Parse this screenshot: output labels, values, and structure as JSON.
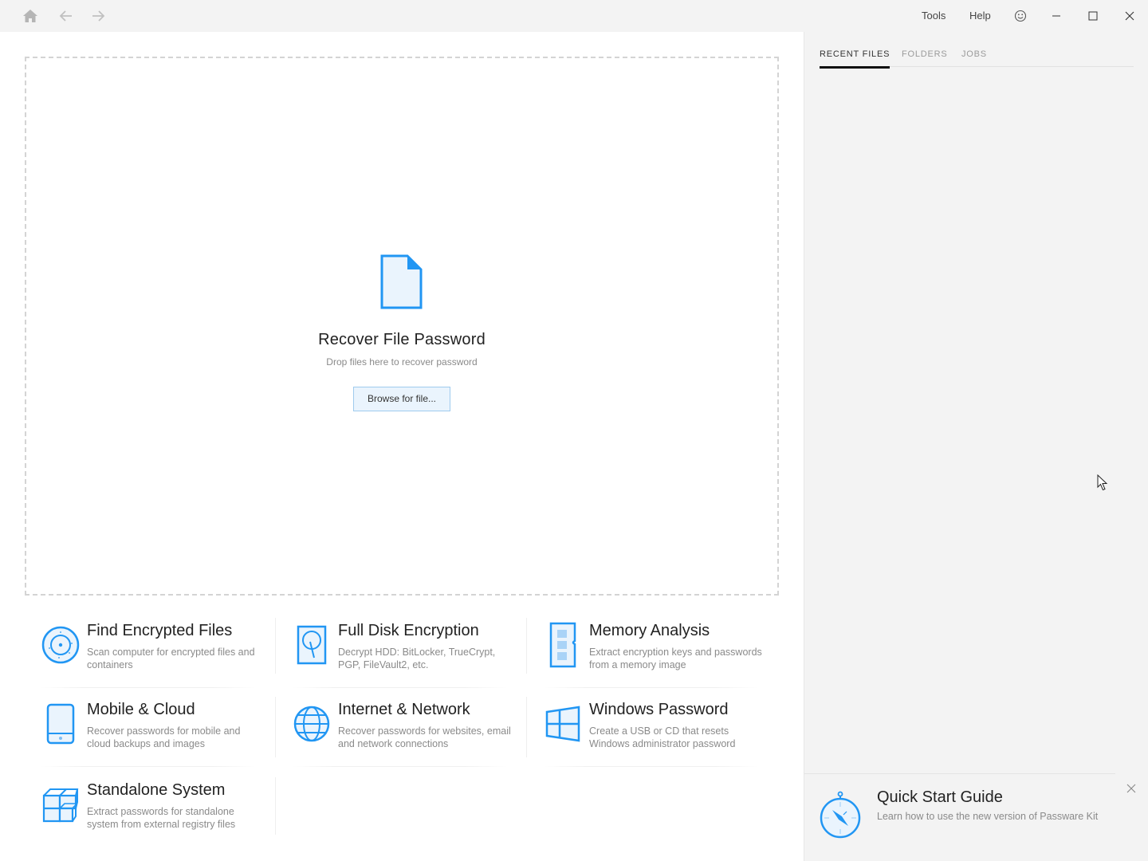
{
  "titlebar": {
    "nav": [
      {
        "icon": "home-icon"
      },
      {
        "icon": "arrow-left-icon"
      },
      {
        "icon": "arrow-right-icon"
      }
    ],
    "menu": {
      "tools": "Tools",
      "help": "Help"
    },
    "feedback_icon": "smiley-icon",
    "window_controls": [
      "minimize-icon",
      "maximize-icon",
      "close-icon"
    ]
  },
  "dropzone": {
    "icon": "file-icon",
    "title": "Recover File Password",
    "subtitle": "Drop files here to recover password",
    "browse_label": "Browse for file..."
  },
  "tiles": [
    {
      "title": "Find Encrypted Files",
      "description": "Scan computer for encrypted files and containers",
      "icon": "disc-scan-icon"
    },
    {
      "title": "Full Disk Encryption",
      "description": "Decrypt HDD: BitLocker, TrueCrypt, PGP, FileVault2, etc.",
      "icon": "hard-disk-icon"
    },
    {
      "title": "Memory Analysis",
      "description": "Extract encryption keys and passwords from a memory image",
      "icon": "memory-module-icon"
    },
    {
      "title": "Mobile & Cloud",
      "description": "Recover passwords for mobile and cloud backups and images",
      "icon": "mobile-device-icon"
    },
    {
      "title": "Internet & Network",
      "description": "Recover passwords for websites, email and network connections",
      "icon": "globe-icon"
    },
    {
      "title": "Windows Password",
      "description": "Create a USB or CD that resets Windows administrator password",
      "icon": "windows-logo-icon"
    },
    {
      "title": "Standalone System",
      "description": "Extract passwords for standalone system from external registry files",
      "icon": "cubes-icon"
    }
  ],
  "sidebar": {
    "tabs": [
      {
        "label": "RECENT FILES",
        "active": true
      },
      {
        "label": "FOLDERS",
        "active": false
      },
      {
        "label": "JOBS",
        "active": false
      }
    ],
    "quick_start": {
      "title": "Quick Start Guide",
      "subtitle": "Learn how to use the new version of Passware Kit",
      "icon": "compass-icon"
    }
  },
  "colors": {
    "accent": "#2196f3",
    "accent_fill": "#e8f3fd",
    "button_bg": "#eaf4fd",
    "button_border": "#9fcbee",
    "sidebar_bg": "#f3f3f3"
  }
}
